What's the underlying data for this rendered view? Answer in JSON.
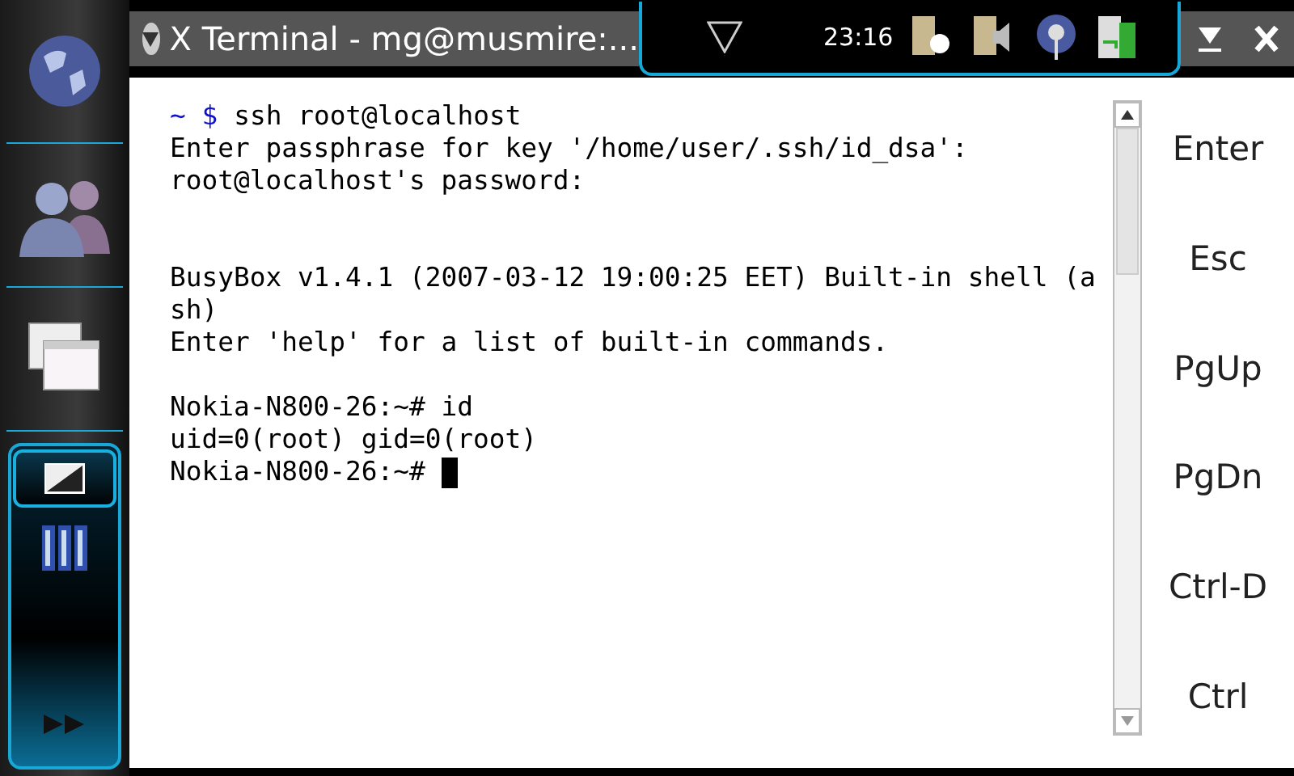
{
  "window": {
    "title": "X Terminal - mg@musmire:..."
  },
  "status_bar": {
    "time": "23:16"
  },
  "title_buttons": [
    {
      "kind": "minimize"
    },
    {
      "kind": "close"
    }
  ],
  "sidebar": {
    "items": [
      {
        "kind": "globe",
        "selected": false
      },
      {
        "kind": "contacts",
        "selected": false
      },
      {
        "kind": "windows",
        "selected": false
      }
    ],
    "tasks": [
      {
        "kind": "terminal",
        "selected": true
      },
      {
        "kind": "books",
        "selected": false
      }
    ]
  },
  "terminal": {
    "lines": [
      {
        "kind": "command",
        "prompt": "~ $",
        "text": "ssh root@localhost"
      },
      {
        "kind": "output",
        "text": "Enter passphrase for key '/home/user/.ssh/id_dsa':"
      },
      {
        "kind": "output",
        "text": "root@localhost's password:"
      },
      {
        "kind": "blank"
      },
      {
        "kind": "blank"
      },
      {
        "kind": "output",
        "text": "BusyBox v1.4.1 (2007-03-12 19:00:25 EET) Built-in shell (a"
      },
      {
        "kind": "output",
        "text": "sh)"
      },
      {
        "kind": "output",
        "text": "Enter 'help' for a list of built-in commands."
      },
      {
        "kind": "blank"
      },
      {
        "kind": "output",
        "text": "Nokia-N800-26:~# id"
      },
      {
        "kind": "output",
        "text": "uid=0(root) gid=0(root)"
      },
      {
        "kind": "output",
        "text": "Nokia-N800-26:~#",
        "cursor": true
      }
    ]
  },
  "keys": [
    "Enter",
    "Esc",
    "PgUp",
    "PgDn",
    "Ctrl-D",
    "Ctrl"
  ]
}
